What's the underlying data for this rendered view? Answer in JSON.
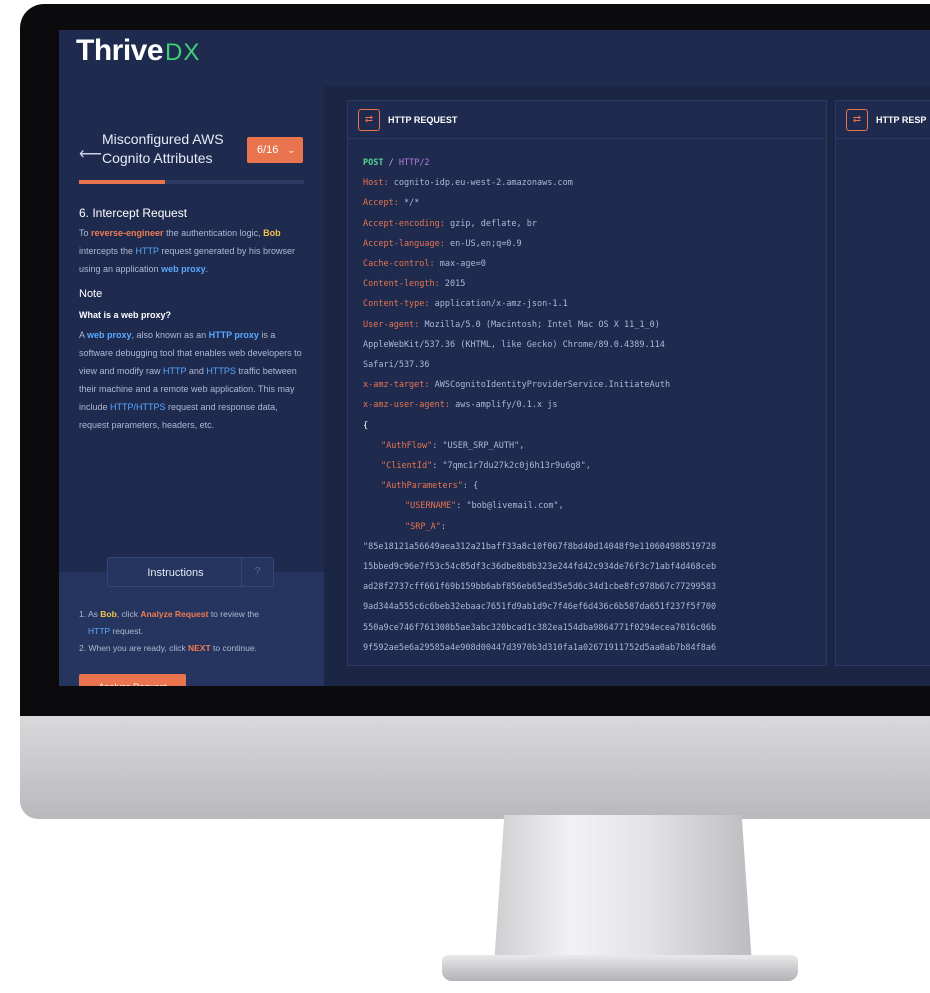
{
  "brand": {
    "name": "Thrive",
    "suffix": "DX"
  },
  "sidebar": {
    "back_icon": "arrow-left-icon",
    "course_title": "Misconfigured AWS Cognito Attributes",
    "step_selector": "6/16",
    "progress_value": 0.38,
    "step_heading": "6. Intercept Request",
    "intro": {
      "t1": "To ",
      "k1": "reverse-engineer",
      "t2": " the authentication logic, ",
      "k2": "Bob",
      "t3": " intercepts the ",
      "k3": "HTTP",
      "t4": " request generated by his browser using an application ",
      "k4": "web proxy",
      "t5": "."
    },
    "note_heading": "Note",
    "question": "What is a web proxy?",
    "answer": {
      "t1": "A ",
      "k1": "web proxy",
      "t2": ", also known as an ",
      "k2": "HTTP proxy",
      "t3": " is a software debugging tool that enables web developers to view and modify raw ",
      "k3": "HTTP",
      "t4": " and ",
      "k4": "HTTPS",
      "t5": " traffic between their machine and a remote web application. This may include ",
      "k5": "HTTP/HTTPS",
      "t6": " request and response data, request parameters, headers, etc."
    },
    "instructions": {
      "tab_label": "Instructions",
      "help_icon": "help-circle-icon",
      "step1": {
        "t1": "1. As ",
        "k1": "Bob",
        "t2": ", click ",
        "k2": "Analyze Request",
        "t3": " to review the ",
        "k3": "HTTP",
        "t4": " request."
      },
      "step2": {
        "t1": "2. When you are ready, click ",
        "k1": "NEXT",
        "t2": " to continue."
      },
      "button": "Analyze Request"
    }
  },
  "request_panel": {
    "title": "HTTP REQUEST",
    "icon": "swap-arrows-icon",
    "method": "POST",
    "path": " / ",
    "protocol": "HTTP/2",
    "headers": [
      {
        "key": "Host",
        "value": "cognito-idp.eu-west-2.amazonaws.com"
      },
      {
        "key": "Accept",
        "value": "*/*"
      },
      {
        "key": "Accept-encoding",
        "value": "gzip, deflate, br"
      },
      {
        "key": "Accept-language",
        "value": "en-US,en;q=0.9"
      },
      {
        "key": "Cache-control",
        "value": "max-age=0"
      },
      {
        "key": "Content-length",
        "value": "2015"
      },
      {
        "key": "Content-type",
        "value": "application/x-amz-json-1.1"
      },
      {
        "key": "User-agent",
        "value": "Mozilla/5.0 (Macintosh; Intel Mac OS X 11_1_0)"
      }
    ],
    "ua_cont1": "AppleWebKit/537.36 (KHTML, like Gecko) Chrome/89.0.4389.114",
    "ua_cont2": "Safari/537.36",
    "headers2": [
      {
        "key": "x-amz-target",
        "value": "AWSCognitoIdentityProviderService.InitiateAuth"
      },
      {
        "key": "x-amz-user-agent",
        "value": "aws-amplify/0.1.x js"
      }
    ],
    "body": {
      "open_brace": "{",
      "authflow_key": "\"AuthFlow\"",
      "authflow_val": "\"USER_SRP_AUTH\",",
      "clientid_key": "\"ClientId\"",
      "clientid_val": "\"7qmc1r7du27k2c0j6h13r9u6g8\",",
      "authparams_key": "\"AuthParameters\"",
      "authparams_open": "{",
      "username_key": "\"USERNAME\"",
      "username_val": "\"bob@livemail.com\",",
      "srpa_key": "\"SRP_A\"",
      "srpa_lines": [
        "\"85e18121a56649aea312a21baff33a8c10f067f8bd40d14048f9e110604988519728",
        "15bbed9c96e7f53c54c85df3c36dbe8b8b323e244fd42c934de76f3c71abf4d468ceb",
        "ad28f2737cff661f69b159bb6abf856eb65ed35e5d6c34d1cbe8fc978b67c77299583",
        "9ad344a555c6c6beb32ebaac7651fd9ab1d9c7f46ef6d436c6b587da651f237f5f700",
        "550a9ce746f761308b5ae3abc320bcad1c382ea154dba9864771f0294ecea7016c06b",
        "9f592ae5e6a29585a4e908d00447d3970b3d310fa1a02671911752d5aa0ab7b84f8a6"
      ]
    }
  },
  "response_panel": {
    "title": "HTTP RESP",
    "icon": "swap-arrows-icon"
  },
  "colors": {
    "accent": "#e9744e",
    "brand_green": "#3ed174",
    "bg": "#1b2645",
    "panel": "#1e2b4f"
  }
}
